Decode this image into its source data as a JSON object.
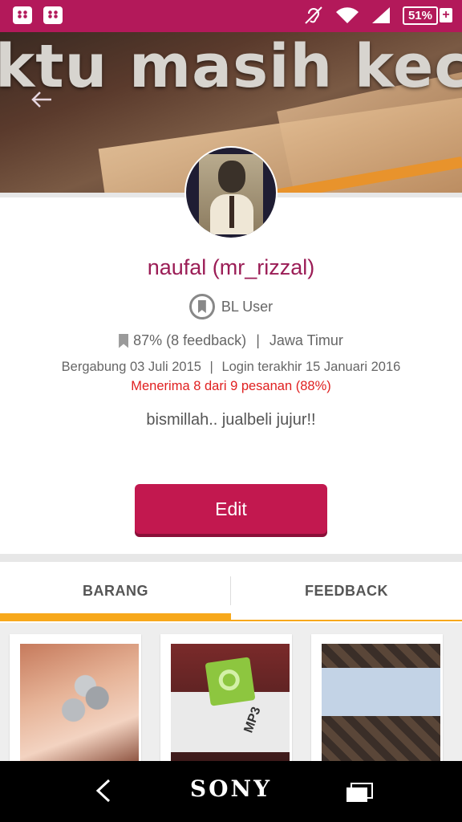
{
  "status_bar": {
    "battery": "51%",
    "battery_plus": "+",
    "notifications": [
      "bbm-icon",
      "bbm-icon"
    ]
  },
  "cover": {
    "caption": "ktu masih kecil..."
  },
  "profile": {
    "name": "naufal (mr_rizzal)",
    "user_type": "BL User",
    "feedback": "87% (8 feedback)",
    "separator": "|",
    "location": "Jawa Timur",
    "joined": "Bergabung 03 Juli 2015",
    "last_login": "Login terakhir 15 Januari 2016",
    "acceptance": "Menerima 8 dari 9 pesanan (88%)",
    "bio": "bismillah..  jualbeli jujur!!"
  },
  "actions": {
    "edit_label": "Edit"
  },
  "tabs": [
    {
      "label": "BARANG",
      "active": true
    },
    {
      "label": "FEEDBACK",
      "active": false
    }
  ],
  "products": [
    {
      "image": "coins-photo"
    },
    {
      "image": "mp3-player-photo",
      "label": "MP3"
    },
    {
      "image": "banknote-photo"
    }
  ],
  "nav_bar": {
    "brand": "SONY"
  },
  "colors": {
    "primary": "#b3195a",
    "button": "#c2184f",
    "accent": "#f7a81b",
    "alert": "#e02020"
  }
}
